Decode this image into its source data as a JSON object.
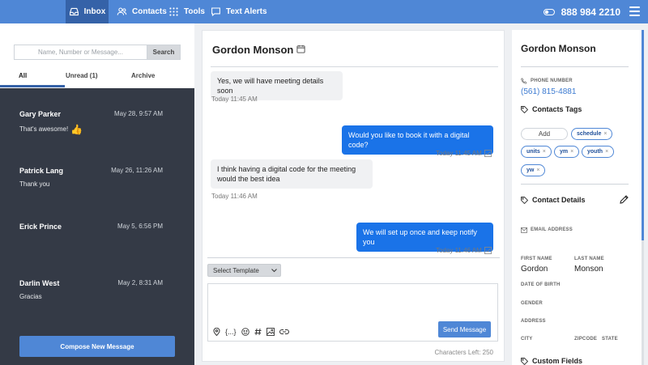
{
  "nav": {
    "items": [
      {
        "label": "Inbox",
        "icon": "inbox-icon",
        "active": true
      },
      {
        "label": "Contacts",
        "icon": "contacts-icon",
        "active": false
      },
      {
        "label": "Tools",
        "icon": "tools-icon",
        "active": false
      },
      {
        "label": "Text Alerts",
        "icon": "chat-icon",
        "active": false
      }
    ],
    "phone": "888 984 2210"
  },
  "left": {
    "search_placeholder": "Name, Number or Message...",
    "search_button": "Search",
    "tabs": [
      "All",
      "Unread (1)",
      "Archive"
    ],
    "conversations": [
      {
        "name": "Gary Parker",
        "date": "May 28, 9:57 AM",
        "preview": "That's awesome!",
        "emoji": "👍"
      },
      {
        "name": "Patrick Lang",
        "date": "May 26, 11:26 AM",
        "preview": "Thank you",
        "emoji": ""
      },
      {
        "name": "Erick Prince",
        "date": "May 5, 6:56 PM",
        "preview": "",
        "emoji": ""
      },
      {
        "name": "Darlin West",
        "date": "May 2, 8:31 AM",
        "preview": "Gracias",
        "emoji": ""
      }
    ],
    "compose_button": "Compose New Message"
  },
  "chat": {
    "title": "Gordon Monson",
    "messages": [
      {
        "dir": "in",
        "text": "Yes, we will have meeting details soon",
        "time": "Today 11:45 AM"
      },
      {
        "dir": "out",
        "text": "Would you like to book it with a digital code?",
        "time": "Today 11:45 AM"
      },
      {
        "dir": "in",
        "text": "I think having a digital code for the meeting would the best idea",
        "time": "Today 11:46 AM"
      },
      {
        "dir": "out",
        "text": "We will set up once and keep notify you",
        "time": "Today 11:46 AM"
      }
    ],
    "template_select": "Select Template",
    "toolbar_variable": "{...}",
    "send_button": "Send Message",
    "chars_left": "Characters Left: 250"
  },
  "contact": {
    "name": "Gordon Monson",
    "phone_label": "PHONE NUMBER",
    "phone": "(561) 815-4881",
    "tags_title": "Contacts Tags",
    "add_label": "Add",
    "tags": [
      "schedule",
      "units",
      "ym",
      "youth",
      "yw"
    ],
    "details_title": "Contact Details",
    "email_label": "EMAIL ADDRESS",
    "first_name_label": "FIRST NAME",
    "first_name": "Gordon",
    "last_name_label": "LAST NAME",
    "last_name": "Monson",
    "dob_label": "DATE OF BIRTH",
    "gender_label": "GENDER",
    "address_label": "ADDRESS",
    "city_label": "CITY",
    "zip_label": "ZIPCODE",
    "state_label": "STATE",
    "custom_fields_title": "Custom Fields"
  },
  "colors": {
    "nav_bg": "#4f87d6",
    "nav_active": "#3562a8",
    "list_bg": "#343a46",
    "bubble_out": "#1a73e8",
    "link": "#3d7bd1"
  }
}
